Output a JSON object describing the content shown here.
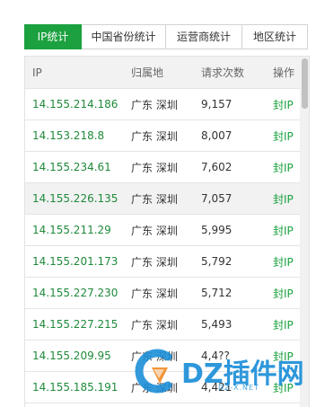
{
  "tabs": [
    {
      "label": "IP统计",
      "active": true
    },
    {
      "label": "中国省份统计",
      "active": false
    },
    {
      "label": "运营商统计",
      "active": false
    },
    {
      "label": "地区统计",
      "active": false
    }
  ],
  "table": {
    "columns": [
      "IP",
      "归属地",
      "请求次数",
      "操作"
    ],
    "rows": [
      {
        "ip": "14.155.214.186",
        "location": "广东 深圳",
        "count": "9,157",
        "action": "封IP"
      },
      {
        "ip": "14.153.218.8",
        "location": "广东 深圳",
        "count": "8,007",
        "action": "封IP"
      },
      {
        "ip": "14.155.234.61",
        "location": "广东 深圳",
        "count": "7,602",
        "action": "封IP"
      },
      {
        "ip": "14.155.226.135",
        "location": "广东 深圳",
        "count": "7,057",
        "action": "封IP"
      },
      {
        "ip": "14.155.211.29",
        "location": "广东 深圳",
        "count": "5,995",
        "action": "封IP"
      },
      {
        "ip": "14.155.201.173",
        "location": "广东 深圳",
        "count": "5,792",
        "action": "封IP"
      },
      {
        "ip": "14.155.227.230",
        "location": "广东 深圳",
        "count": "5,712",
        "action": "封IP"
      },
      {
        "ip": "14.155.227.215",
        "location": "广东 深圳",
        "count": "5,493",
        "action": "封IP"
      },
      {
        "ip": "14.155.209.95",
        "location": "广东 深圳",
        "count": "4,4??",
        "action": "封IP"
      },
      {
        "ip": "14.155.185.191",
        "location": "广东 深圳",
        "count": "4,421",
        "action": "封IP"
      }
    ]
  },
  "watermark": {
    "brand": "DZ插件网",
    "domain": "DZ-X.NET"
  },
  "colors": {
    "accent": "#1ba13f",
    "ip_text": "#1f8a3a",
    "watermark": "#1d8fd8"
  }
}
